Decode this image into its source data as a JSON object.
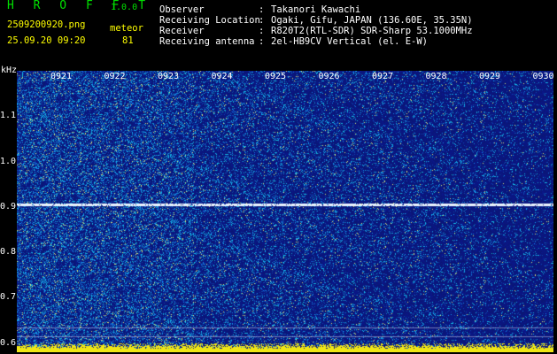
{
  "header": {
    "app_name": "H R O F F T",
    "app_version": "1.0.0",
    "filename": "2509200920.png",
    "datetime": "25.09.20 09:20",
    "detector_label": "meteor",
    "count": "81"
  },
  "info": {
    "rows": [
      {
        "label": "Observer",
        "value": "Takanori Kawachi"
      },
      {
        "label": "Receiving Location",
        "value": "Ogaki, Gifu, JAPAN (136.60E, 35.35N)"
      },
      {
        "label": "Receiver",
        "value": "R820T2(RTL-SDR) SDR-Sharp 53.1000MHz"
      },
      {
        "label": "Receiving antenna",
        "value": "2el-HB9CV Vertical (el. E-W)"
      }
    ],
    "separator": ":"
  },
  "spectrogram": {
    "y_unit": "kHz",
    "y_ticks": [
      "1.1",
      "1.0",
      "0.9",
      "0.8",
      "0.7",
      "0.6"
    ],
    "x_ticks": [
      "0921",
      "0922",
      "0923",
      "0924",
      "0925",
      "0926",
      "0927",
      "0928",
      "0929",
      "0930"
    ],
    "freq_range_khz": [
      0.58,
      1.2
    ],
    "carrier_line_khz": 0.905,
    "colors": {
      "background": "#0a1670",
      "noise_high": "#28c8e0",
      "signal": "#ffffff",
      "baseline": "#ffff00"
    }
  }
}
